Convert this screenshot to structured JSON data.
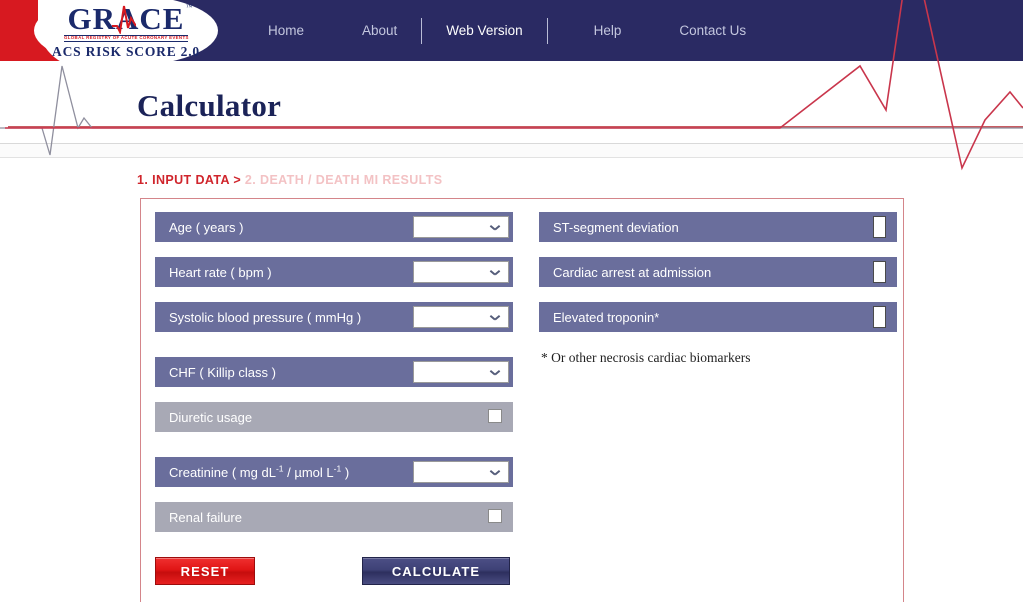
{
  "header": {
    "logo": {
      "brand": "GRACE",
      "trademark": "™",
      "subtitle": "GLOBAL REGISTRY OF ACUTE CORONARY EVENTS",
      "tagline": "ACS RISK SCORE 2.0"
    },
    "nav": [
      {
        "label": "Home",
        "active": false
      },
      {
        "label": "About",
        "active": false
      },
      {
        "label": "Web Version",
        "active": true
      },
      {
        "label": "Help",
        "active": false
      },
      {
        "label": "Contact Us",
        "active": false
      }
    ]
  },
  "page": {
    "title": "Calculator"
  },
  "breadcrumb": {
    "active_step": "1. INPUT DATA >",
    "inactive_step": "2. DEATH / DEATH MI RESULTS"
  },
  "form": {
    "left_fields": [
      {
        "label": "Age ( years )",
        "control": "select",
        "value": "",
        "disabled": false
      },
      {
        "label": "Heart rate ( bpm )",
        "control": "select",
        "value": "",
        "disabled": false
      },
      {
        "label": "Systolic blood pressure ( mmHg )",
        "control": "select",
        "value": "",
        "disabled": false
      },
      {
        "label": "CHF ( Killip class )",
        "control": "select",
        "value": "",
        "disabled": false
      },
      {
        "label": "Diuretic usage",
        "control": "checkbox",
        "checked": false,
        "disabled": true
      },
      {
        "label": "Creatinine ( mg dL",
        "label_sup1": "-1",
        "label_mid": " / µmol L",
        "label_sup2": "-1",
        "label_end": " )",
        "control": "select",
        "value": "",
        "disabled": false
      },
      {
        "label": "Renal failure",
        "control": "checkbox",
        "checked": false,
        "disabled": true
      }
    ],
    "right_fields": [
      {
        "label": "ST-segment deviation",
        "control": "checkbox",
        "checked": false,
        "disabled": false
      },
      {
        "label": "Cardiac arrest at admission",
        "control": "checkbox",
        "checked": false,
        "disabled": false
      },
      {
        "label": "Elevated troponin*",
        "control": "checkbox",
        "checked": false,
        "disabled": false
      }
    ],
    "footnote": "* Or other necrosis cardiac biomarkers",
    "buttons": {
      "reset": "RESET",
      "calculate": "CALCULATE"
    }
  },
  "colors": {
    "header_navy": "#2a2a63",
    "logo_red": "#d71920",
    "field_purple": "#6a6e9c",
    "field_gray": "#a8a9b5",
    "breadcrumb_active": "#d0252c",
    "breadcrumb_inactive": "#f3c2c4",
    "panel_border": "#d4858a",
    "ekg_red": "#c9364c",
    "ekg_gray": "#8f8f9e",
    "title_navy": "#1b2358"
  }
}
